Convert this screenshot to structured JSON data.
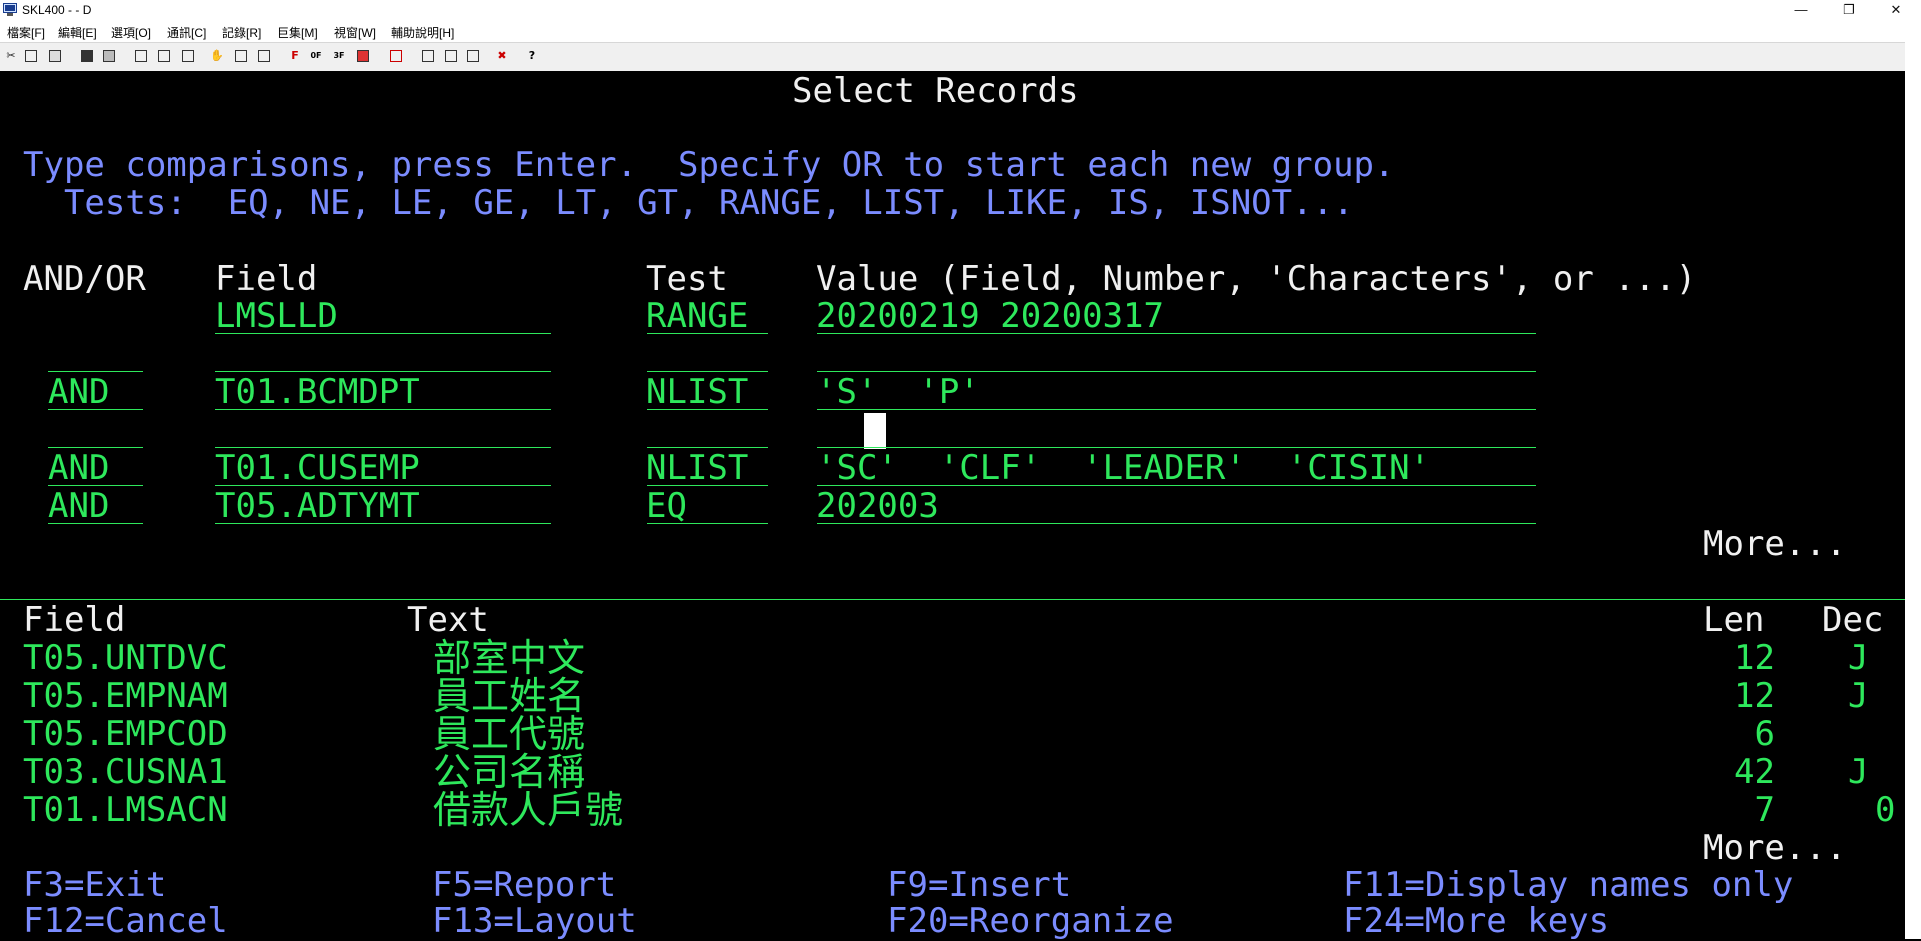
{
  "window": {
    "title": "SKL400 - - D",
    "minimize_glyph": "—",
    "restore_glyph": "❐",
    "close_glyph": "✕"
  },
  "menu": [
    "檔案[F]",
    "編輯[E]",
    "選項[O]",
    "通訊[C]",
    "記錄[R]",
    "巨集[M]",
    "視窗[W]",
    "輔助說明[H]"
  ],
  "toolbar_icons": [
    "cut-icon",
    "copy-icon",
    "paste-icon",
    "save-icon",
    "print-icon",
    "send-icon",
    "receive-icon",
    "transfer-icon",
    "hand-icon",
    "keyboard-icon",
    "keypad-icon",
    "font-icon",
    "toggle-icon",
    "color-icon",
    "grid-icon",
    "window-icon",
    "macro-record-icon",
    "macro-play-icon",
    "macro-stop-icon",
    "disconnect-icon",
    "help-icon"
  ],
  "screen": {
    "title": "Select Records",
    "instruction1": "Type comparisons, press Enter.  Specify OR to start each new group.",
    "instruction2": "  Tests:  EQ, NE, LE, GE, LT, GT, RANGE, LIST, LIKE, IS, ISNOT...",
    "headers": {
      "andor": "AND/OR",
      "field": "Field",
      "test": "Test",
      "value": "Value (Field, Number, 'Characters', or ...)"
    },
    "rows": [
      {
        "andor": "",
        "field": "LMSLLD",
        "test": "RANGE",
        "value": "20200219 20200317"
      },
      {
        "andor": "",
        "field": "",
        "test": "",
        "value": ""
      },
      {
        "andor": "AND",
        "field": "T01.BCMDPT",
        "test": "NLIST",
        "value": "'S'  'P'"
      },
      {
        "andor": "",
        "field": "",
        "test": "",
        "value": ""
      },
      {
        "andor": "AND",
        "field": "T01.CUSEMP",
        "test": "NLIST",
        "value": "'SC'  'CLF'  'LEADER'  'CISIN'"
      },
      {
        "andor": "AND",
        "field": "T05.ADTYMT",
        "test": "EQ",
        "value": "202003"
      }
    ],
    "more1": "More...",
    "list_headers": {
      "field": "Field",
      "text": "Text",
      "len": "Len",
      "dec": "Dec"
    },
    "list": [
      {
        "field": "T05.UNTDVC",
        "text": "部室中文",
        "len": "12",
        "dec": "J"
      },
      {
        "field": "T05.EMPNAM",
        "text": "員工姓名",
        "len": "12",
        "dec": "J"
      },
      {
        "field": "T05.EMPCOD",
        "text": "員工代號",
        "len": "6",
        "dec": ""
      },
      {
        "field": "T03.CUSNA1",
        "text": "公司名稱",
        "len": "42",
        "dec": "J"
      },
      {
        "field": "T01.LMSACN",
        "text": "借款人戶號",
        "len": "7",
        "dec": "0"
      }
    ],
    "more2": "More...",
    "fkeys": [
      "F3=Exit",
      "F5=Report",
      "F9=Insert",
      "F11=Display names only",
      "F12=Cancel",
      "F13=Layout",
      "F20=Reorganize",
      "F24=More keys"
    ]
  }
}
